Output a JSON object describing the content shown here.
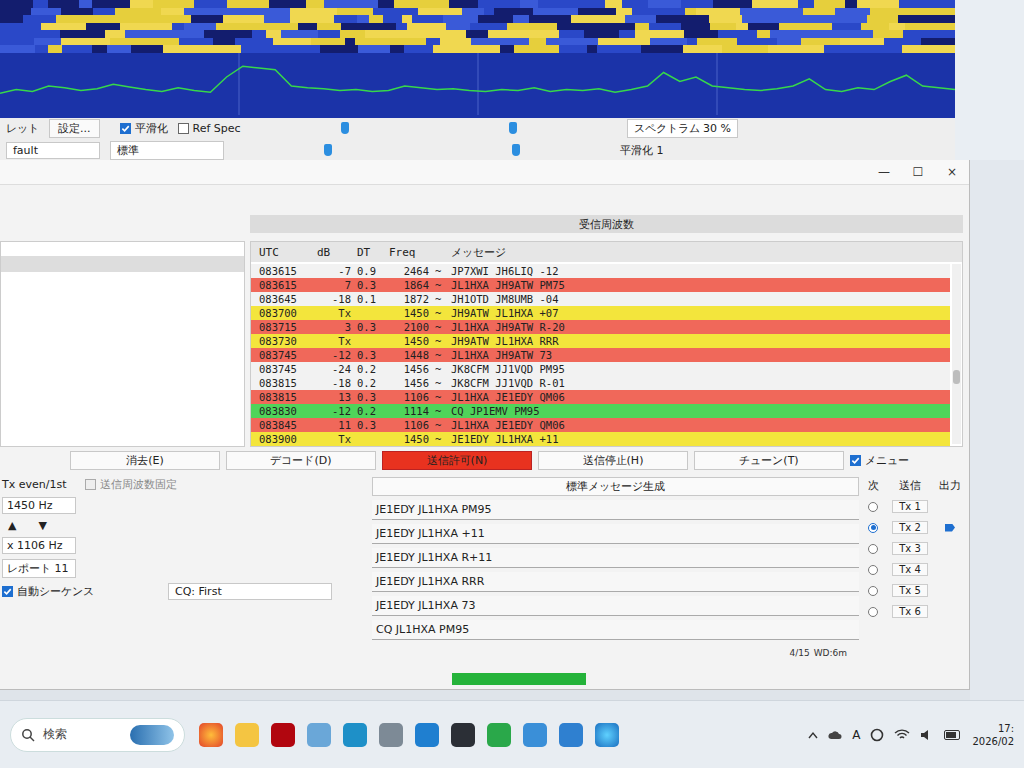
{
  "waterfall": {
    "spectrum": [
      22,
      26,
      24,
      30,
      28,
      25,
      27,
      32,
      29,
      26,
      24,
      28,
      25,
      23,
      40,
      52,
      50,
      48,
      30,
      28,
      27,
      25,
      26,
      24,
      25,
      30,
      28,
      26,
      27,
      25,
      24,
      26,
      25,
      28,
      24,
      26,
      25,
      27,
      23,
      26,
      30,
      45,
      35,
      40,
      30,
      28,
      26,
      25,
      27,
      30,
      38,
      26,
      24,
      28,
      26,
      35,
      42,
      30,
      28,
      26
    ]
  },
  "controls": {
    "palette_label": "レット",
    "settings_button": "設定...",
    "palette_value": "fault",
    "smoothing": {
      "label": "平滑化",
      "checked": true
    },
    "ref_spec": {
      "label": "Ref Spec",
      "checked": false
    },
    "mode": "標準",
    "spectrum": "スペクトラム 30 %",
    "smooth_value": "平滑化 1"
  },
  "window": {
    "controls": [
      "—",
      "☐",
      "×"
    ]
  },
  "panes": {
    "right_title": "受信周波数"
  },
  "table": {
    "columns": [
      "UTC",
      "dB",
      "DT",
      "Freq",
      "",
      "メッセージ"
    ],
    "rows": [
      {
        "cells": [
          "083615",
          "-7",
          "0.9",
          "2464",
          "~",
          "JP7XWI JH6LIQ -12"
        ],
        "color": "#f2f2f2"
      },
      {
        "cells": [
          "083615",
          "7",
          "0.3",
          "1864",
          "~",
          "JL1HXA JH9ATW PM75"
        ],
        "color": "#f0685a"
      },
      {
        "cells": [
          "083645",
          "-18",
          "0.1",
          "1872",
          "~",
          "JH1OTD JM8UMB -04"
        ],
        "color": "#f2f2f2"
      },
      {
        "cells": [
          "083700",
          "Tx",
          "",
          "1450",
          "~",
          "JH9ATW JL1HXA +07"
        ],
        "color": "#f3e53c"
      },
      {
        "cells": [
          "083715",
          "3",
          "0.3",
          "2100",
          "~",
          "JL1HXA JH9ATW R-20"
        ],
        "color": "#f0685a"
      },
      {
        "cells": [
          "083730",
          "Tx",
          "",
          "1450",
          "~",
          "JH9ATW JL1HXA RRR"
        ],
        "color": "#f3e53c"
      },
      {
        "cells": [
          "083745",
          "-12",
          "0.3",
          "1448",
          "~",
          "JL1HXA JH9ATW 73"
        ],
        "color": "#f0685a"
      },
      {
        "cells": [
          "083745",
          "-24",
          "0.2",
          "1456",
          "~",
          "JK8CFM JJ1VQD PM95"
        ],
        "color": "#f2f2f2"
      },
      {
        "cells": [
          "083815",
          "-18",
          "0.2",
          "1456",
          "~",
          "JK8CFM JJ1VQD R-01"
        ],
        "color": "#f2f2f2"
      },
      {
        "cells": [
          "083815",
          "13",
          "0.3",
          "1106",
          "~",
          "JL1HXA JE1EDY QM06"
        ],
        "color": "#f0685a"
      },
      {
        "cells": [
          "083830",
          "-12",
          "0.2",
          "1114",
          "~",
          "CQ JP1EMV PM95"
        ],
        "color": "#4fd45a"
      },
      {
        "cells": [
          "083845",
          "11",
          "0.3",
          "1106",
          "~",
          "JL1HXA JE1EDY QM06"
        ],
        "color": "#f0685a"
      },
      {
        "cells": [
          "083900",
          "Tx",
          "",
          "1450",
          "~",
          "JE1EDY JL1HXA +11"
        ],
        "color": "#f3e53c"
      }
    ]
  },
  "buttons": [
    {
      "label": "消去(E)",
      "active": false
    },
    {
      "label": "デコード(D)",
      "active": false
    },
    {
      "label": "送信許可(N)",
      "active": true
    },
    {
      "label": "送信停止(H)",
      "active": false
    },
    {
      "label": "チューン(T)",
      "active": false
    }
  ],
  "menu_checkbox": {
    "label": "メニュー",
    "checked": true
  },
  "left_controls": {
    "tx_even": "Tx even/1st",
    "hold_tx": {
      "label": "送信周波数固定",
      "checked": false,
      "disabled": true
    },
    "tx_freq": "1450 Hz",
    "up": "▲",
    "down": "▼",
    "rx_freq": "x 1106 Hz",
    "report": "レポート 11",
    "auto_seq": {
      "label": "自動シーケンス",
      "checked": true
    },
    "cq": "CQ: First"
  },
  "messages": {
    "generate": "標準メッセージ生成",
    "next_label": "次",
    "tx_label": "送信",
    "output_label": "出力",
    "items": [
      {
        "text": "JE1EDY JL1HXA PM95",
        "tx": "Tx 1",
        "selected": false
      },
      {
        "text": "JE1EDY JL1HXA +11",
        "tx": "Tx 2",
        "selected": true
      },
      {
        "text": "JE1EDY JL1HXA R+11",
        "tx": "Tx 3",
        "selected": false
      },
      {
        "text": "JE1EDY JL1HXA RRR",
        "tx": "Tx 4",
        "selected": false
      },
      {
        "text": "JE1EDY JL1HXA 73",
        "tx": "Tx 5",
        "selected": false
      },
      {
        "text": "CQ JL1HXA PM95",
        "tx": "Tx 6",
        "selected": false
      }
    ]
  },
  "status": {
    "period": "4/15",
    "wd": "WD:6m",
    "level": 1
  },
  "taskbar": {
    "search": "検索",
    "tray_letter": "A",
    "time": "17:",
    "date": "2026/02"
  }
}
